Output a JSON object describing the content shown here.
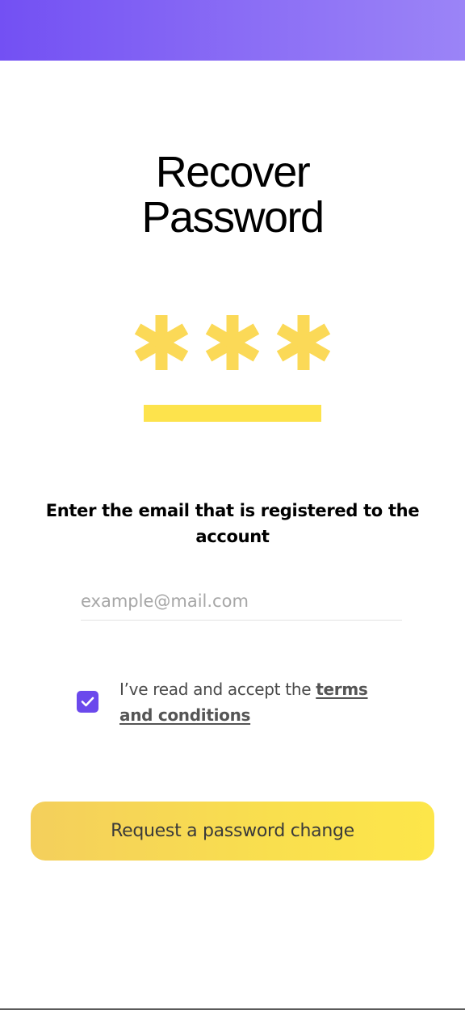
{
  "header": {
    "accent_color": "#7350f3"
  },
  "title": {
    "line1": "Recover",
    "line2": "Password"
  },
  "illustration": {
    "icon": "password-asterisks-icon",
    "color": "#fde34c"
  },
  "form": {
    "prompt": "Enter the email that is registered to the account",
    "email_placeholder": "example@mail.com",
    "email_value": "",
    "terms": {
      "checked": true,
      "text_prefix": "I’ve read and accept the ",
      "link_text": "terms and conditions",
      "checkbox_color": "#6b49ec"
    },
    "submit_label": "Request a password change"
  }
}
